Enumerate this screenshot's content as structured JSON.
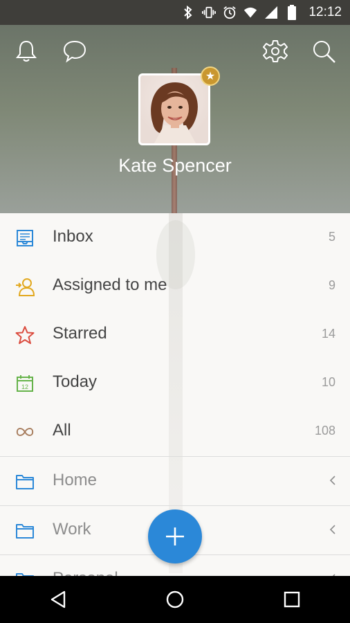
{
  "status": {
    "time": "12:12"
  },
  "header": {
    "user_name": "Kate Spencer"
  },
  "lists": [
    {
      "label": "Inbox",
      "count": "5",
      "color": "#2b88d8"
    },
    {
      "label": "Assigned to me",
      "count": "9",
      "color": "#e2a81e"
    },
    {
      "label": "Starred",
      "count": "14",
      "color": "#db4c3f"
    },
    {
      "label": "Today",
      "count": "10",
      "color": "#66b34a"
    },
    {
      "label": "All",
      "count": "108",
      "color": "#a67b5b"
    }
  ],
  "folders": [
    {
      "label": "Home"
    },
    {
      "label": "Work"
    },
    {
      "label": "Personal"
    }
  ],
  "colors": {
    "accent": "#2b88d8",
    "folder": "#2b88d8"
  },
  "icons": {
    "status": [
      "bluetooth-icon",
      "vibrate-icon",
      "alarm-icon",
      "wifi-icon",
      "signal-icon",
      "battery-icon"
    ],
    "header": [
      "notifications-bell-icon",
      "conversations-icon",
      "settings-gear-icon",
      "search-icon"
    ],
    "nav": [
      "back-icon",
      "home-icon",
      "recents-icon"
    ]
  }
}
